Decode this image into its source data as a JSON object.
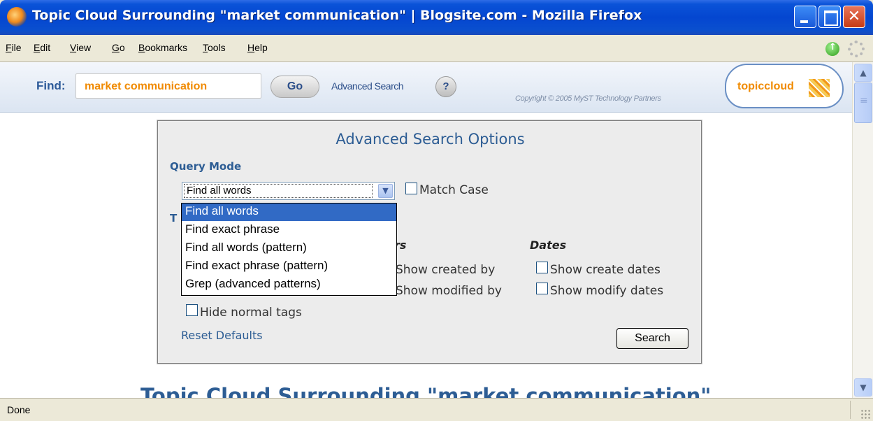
{
  "window": {
    "title": "Topic Cloud Surrounding \"market communication\" | Blogsite.com - Mozilla Firefox",
    "close_glyph": "✕"
  },
  "menu": {
    "file": "File",
    "edit": "Edit",
    "view": "View",
    "go": "Go",
    "bookmarks": "Bookmarks",
    "tools": "Tools",
    "help": "Help"
  },
  "findbar": {
    "label": "Find:",
    "query": "market communication",
    "go_label": "Go",
    "advanced_link": "Advanced Search",
    "help_label": "?",
    "copyright": "Copyright © 2005 MyST Technology Partners",
    "logo_text_a": "topic",
    "logo_text_b": "cloud"
  },
  "advanced": {
    "title": "Advanced Search Options",
    "query_mode_label": "Query Mode",
    "selected_mode": "Find all words",
    "match_case_label": "Match Case",
    "partial_heading": "T",
    "users_heading_partial": "rs",
    "dates_heading": "Dates",
    "show_created_by_partial": "Show created by",
    "show_modified_by_partial": "Show modified by",
    "show_create_dates": "Show create dates",
    "show_modify_dates": "Show modify dates",
    "hide_normal_tags": "Hide normal tags",
    "reset_defaults": "Reset Defaults",
    "search_button": "Search",
    "dropdown_options": [
      "Find all words",
      "Find exact phrase",
      "Find all words (pattern)",
      "Find exact phrase (pattern)",
      "Grep (advanced patterns)"
    ]
  },
  "page": {
    "result_heading": "Topic Cloud Surrounding \"market communication\""
  },
  "status": {
    "text": "Done"
  }
}
